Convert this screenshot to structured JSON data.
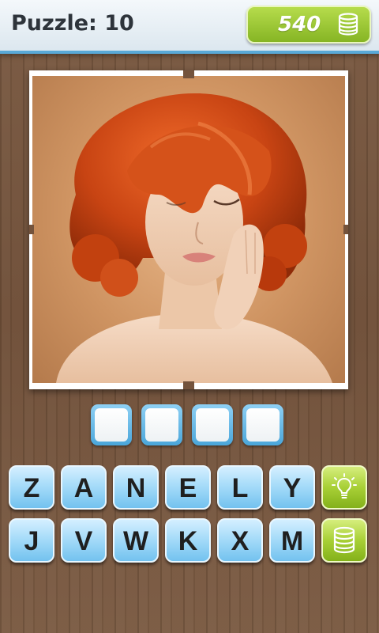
{
  "header": {
    "title": "Puzzle: 10",
    "coins": "540",
    "coin_icon": "coin-stack-icon"
  },
  "puzzle": {
    "image_icon": "puzzle-photo",
    "answer_slots": [
      "",
      "",
      "",
      ""
    ]
  },
  "letters": {
    "row1": [
      "Z",
      "A",
      "N",
      "E",
      "L",
      "Y"
    ],
    "row2": [
      "J",
      "V",
      "W",
      "K",
      "X",
      "M"
    ]
  },
  "actions": {
    "hint_icon": "lightbulb-icon",
    "buy_coins_icon": "coin-stack-icon"
  },
  "colors": {
    "tile_blue": "#a7dcf9",
    "action_green": "#a8d036",
    "header_accent": "#59a9d7",
    "wood": "#74533c"
  }
}
